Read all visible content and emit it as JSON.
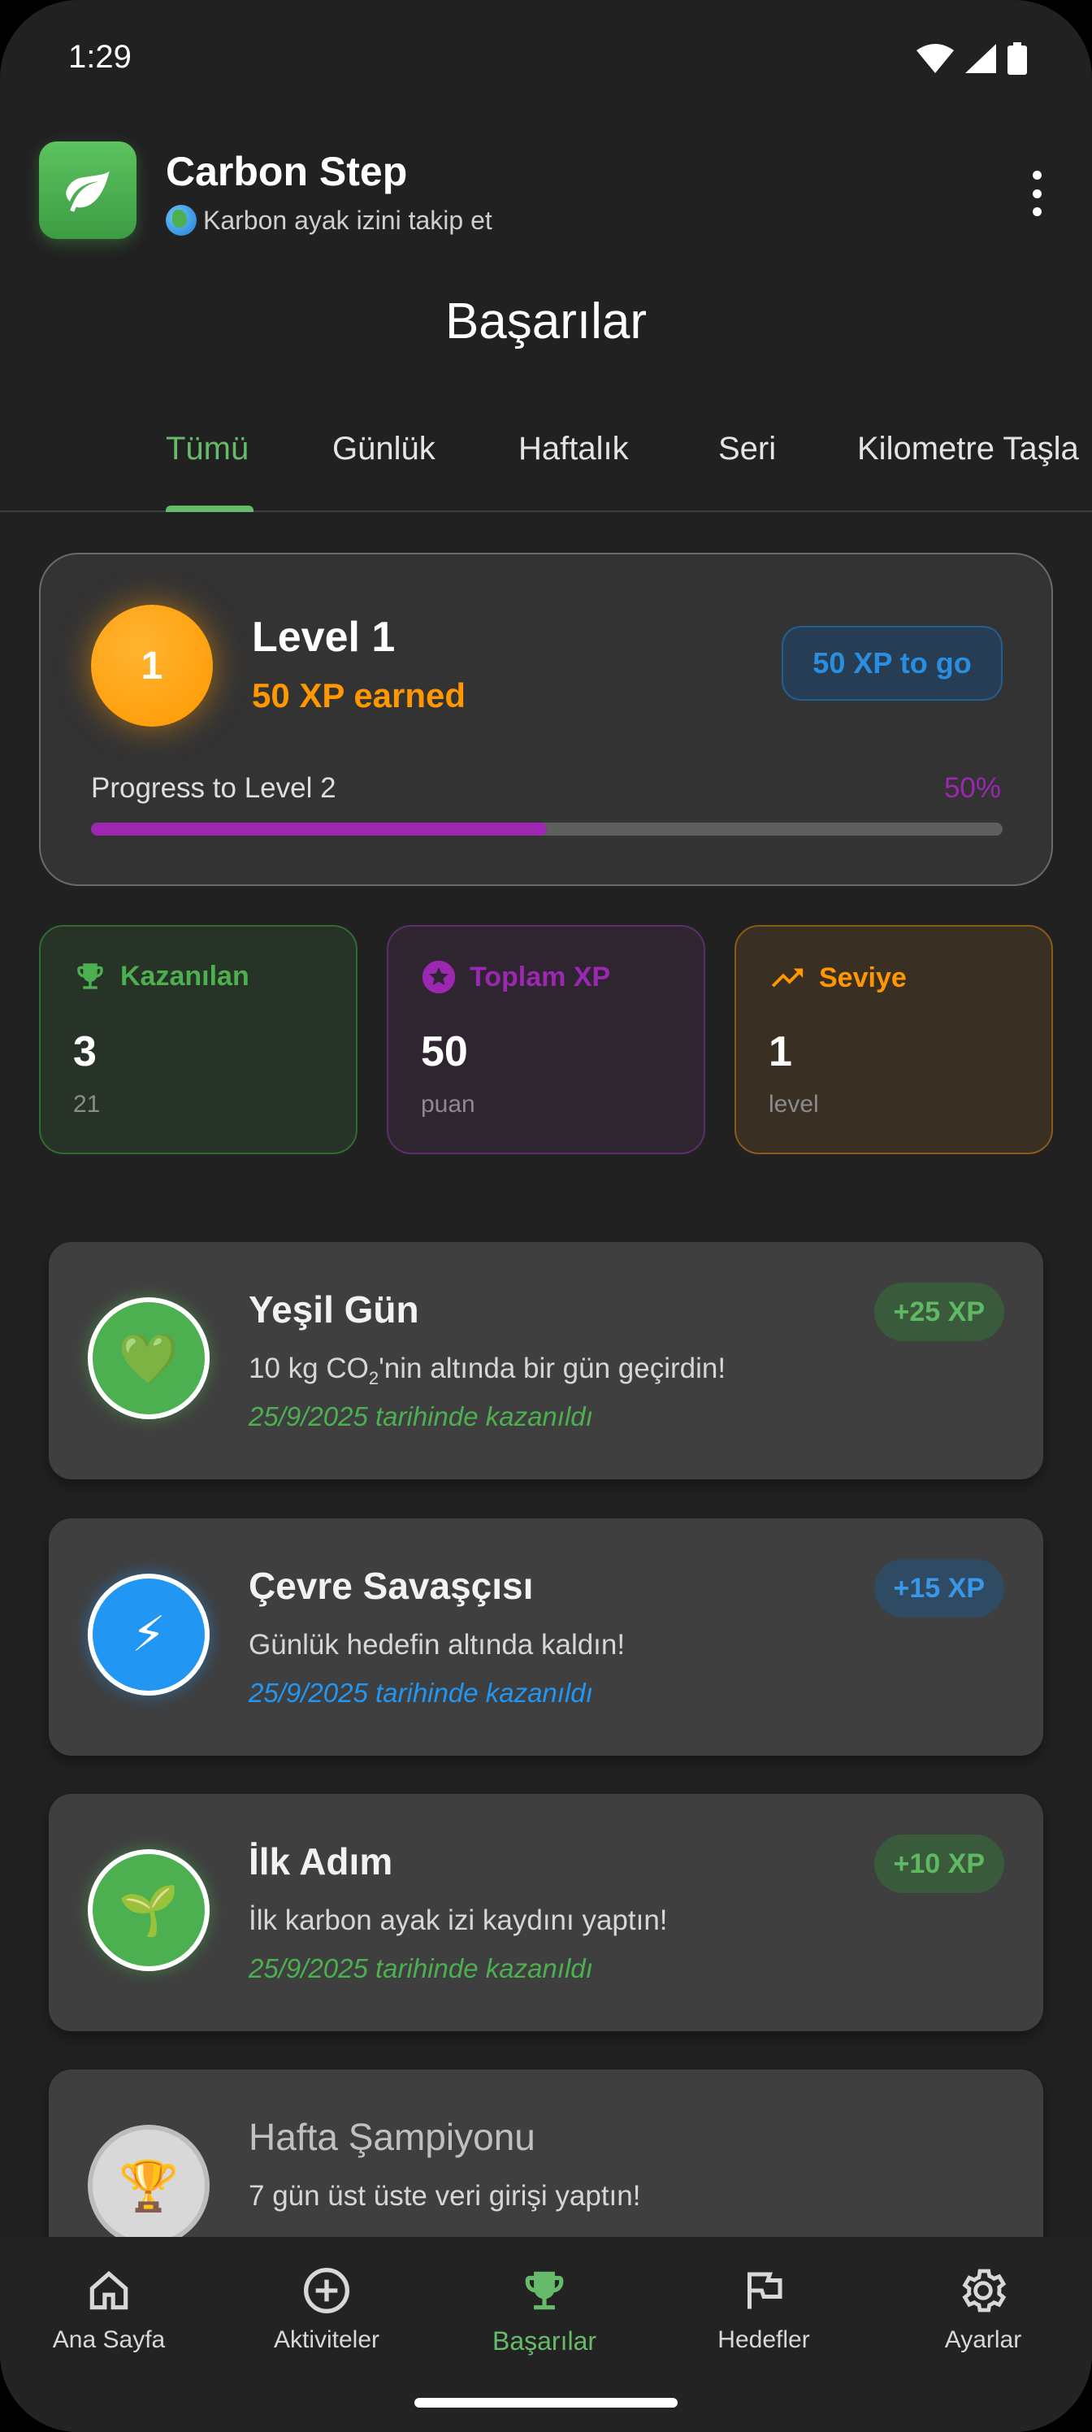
{
  "status_bar": {
    "time": "1:29"
  },
  "app": {
    "title": "Carbon Step",
    "subtitle": "Karbon ayak izini takip et"
  },
  "page": {
    "title": "Başarılar"
  },
  "tabs": [
    {
      "label": "Tümü",
      "active": true
    },
    {
      "label": "Günlük"
    },
    {
      "label": "Haftalık"
    },
    {
      "label": "Seri"
    },
    {
      "label": "Kilometre Taşla"
    }
  ],
  "level_card": {
    "badge": "1",
    "title": "Level 1",
    "xp_earned": "50 XP earned",
    "xp_to_go": "50 XP to go",
    "progress_label": "Progress to Level 2",
    "progress_pct": "50%",
    "progress_value": 0.5
  },
  "stats": [
    {
      "label": "Kazanılan",
      "value": "3",
      "sub": "21",
      "icon": "trophy-icon",
      "color": "#4caf50"
    },
    {
      "label": "Toplam XP",
      "value": "50",
      "sub": "puan",
      "icon": "star-icon",
      "color": "#9c27b0"
    },
    {
      "label": "Seviye",
      "value": "1",
      "sub": "level",
      "icon": "trending-up-icon",
      "color": "#ff9800"
    }
  ],
  "achievements": [
    {
      "title": "Yeşil Gün",
      "desc_pre": "10 kg CO",
      "desc_sub": "2",
      "desc_post": "'nin altında bir gün geçirdin!",
      "date": "25/9/2025 tarihinde kazanıldı",
      "xp": "+25 XP",
      "icon": "green-heart-icon",
      "glyph": "💚",
      "color": "#4caf50"
    },
    {
      "title": "Çevre Savaşçısı",
      "desc": "Günlük hedefin altında kaldın!",
      "date": "25/9/2025 tarihinde kazanıldı",
      "xp": "+15 XP",
      "icon": "lightning-icon",
      "glyph": "⚡",
      "color": "#2196f3"
    },
    {
      "title": "İlk Adım",
      "desc": "İlk karbon ayak izi kaydını yaptın!",
      "date": "25/9/2025 tarihinde kazanıldı",
      "xp": "+10 XP",
      "icon": "seedling-icon",
      "glyph": "🌱",
      "color": "#4caf50"
    },
    {
      "title": "Hafta Şampiyonu",
      "desc": "7 gün üst üste veri girişi yaptın!",
      "icon": "trophy-icon",
      "glyph": "🏆",
      "locked": true
    }
  ],
  "bottom_nav": [
    {
      "label": "Ana Sayfa",
      "icon": "home-icon"
    },
    {
      "label": "Aktiviteler",
      "icon": "add-circle-icon"
    },
    {
      "label": "Başarılar",
      "icon": "trophy-icon",
      "active": true
    },
    {
      "label": "Hedefler",
      "icon": "flag-icon"
    },
    {
      "label": "Ayarlar",
      "icon": "gear-icon"
    }
  ]
}
